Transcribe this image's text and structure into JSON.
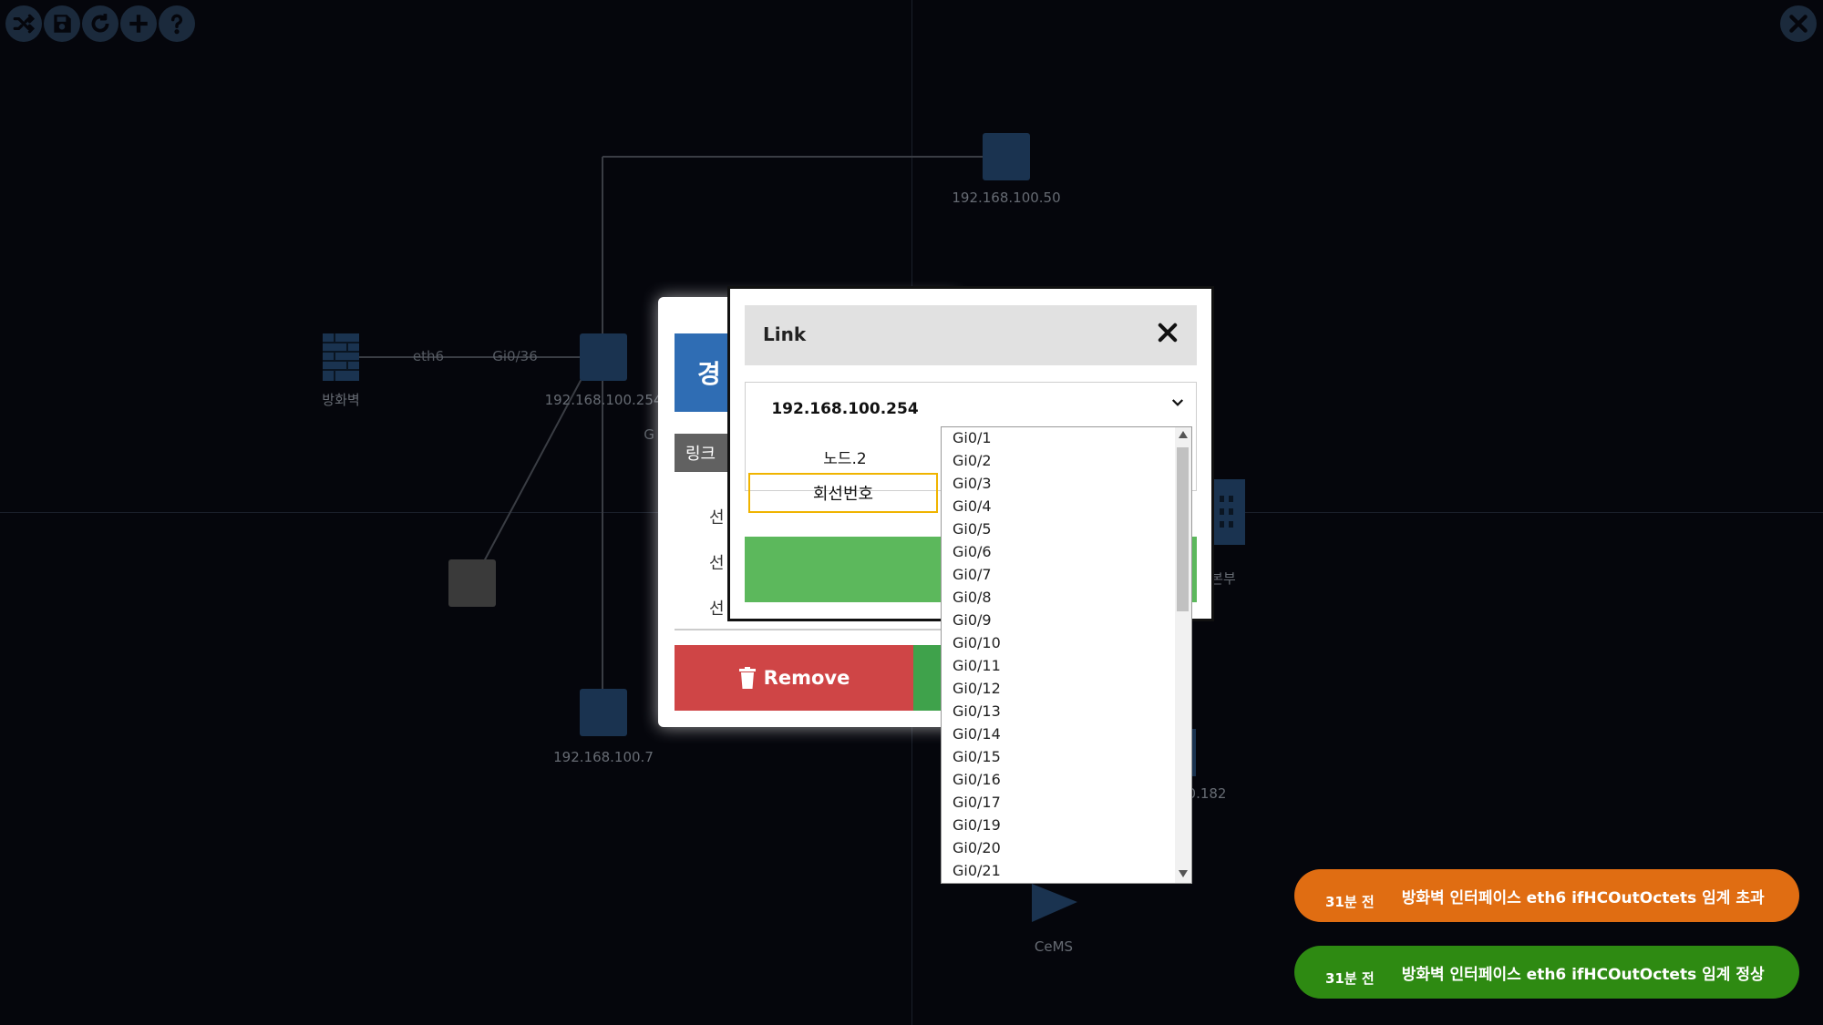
{
  "toolbar": {
    "buttons": [
      "shuffle-icon",
      "save-icon",
      "refresh-icon",
      "plus-icon",
      "help-icon"
    ],
    "close": "close-icon"
  },
  "topology": {
    "nodes": {
      "top_switch": "192.168.100.50",
      "firewall": "방화벽",
      "core_switch": "192.168.100.254",
      "bottom_switch": "192.168.100.7",
      "right_building": "본부",
      "right_node": "0.182",
      "cems": "CeMS"
    },
    "link_labels": {
      "firewall_port": "eth6",
      "switch_port": "Gi0/36",
      "partial": "G"
    }
  },
  "back_modal": {
    "blue_button": "경",
    "tab": "링크",
    "rows": [
      "선",
      "선",
      "선"
    ],
    "remove_label": "Remove"
  },
  "link_modal": {
    "title": "Link",
    "node1_ip": "192.168.100.254",
    "node2_label": "노드.2",
    "line_number_label": "회선번호",
    "selected_value": ""
  },
  "dropdown_options": [
    "Gi0/1",
    "Gi0/2",
    "Gi0/3",
    "Gi0/4",
    "Gi0/5",
    "Gi0/6",
    "Gi0/7",
    "Gi0/8",
    "Gi0/9",
    "Gi0/10",
    "Gi0/11",
    "Gi0/12",
    "Gi0/13",
    "Gi0/14",
    "Gi0/15",
    "Gi0/16",
    "Gi0/17",
    "Gi0/19",
    "Gi0/20",
    "Gi0/21"
  ],
  "toasts": [
    {
      "time": "31분 전",
      "message": "방화벽 인터페이스 eth6 ifHCOutOctets 임계 초과",
      "color": "#e06d12"
    },
    {
      "time": "31분 전",
      "message": "방화벽 인터페이스 eth6 ifHCOutOctets 임계 정상",
      "color": "#2e8a12"
    }
  ],
  "colors": {
    "background": "#05060c",
    "node_blue": "#1a3350",
    "remove_red": "#cf4546",
    "action_green": "#5cb85c",
    "modal_blue": "#2f6db4"
  }
}
